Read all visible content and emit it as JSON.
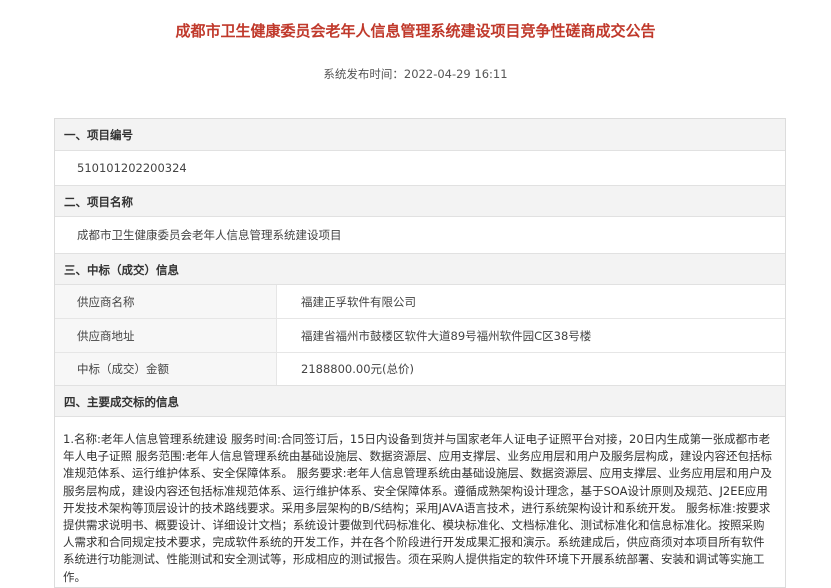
{
  "header": {
    "title": "成都市卫生健康委员会老年人信息管理系统建设项目竞争性磋商成交公告",
    "publish_time": "系统发布时间：2022-04-29 16:11"
  },
  "sections": {
    "s1": {
      "heading": "一、项目编号",
      "value": "510101202200324"
    },
    "s2": {
      "heading": "二、项目名称",
      "value": "成都市卫生健康委员会老年人信息管理系统建设项目"
    },
    "s3": {
      "heading": "三、中标（成交）信息",
      "rows": [
        {
          "key": "供应商名称",
          "value": "福建正孚软件有限公司"
        },
        {
          "key": "供应商地址",
          "value": "福建省福州市鼓楼区软件大道89号福州软件园C区38号楼"
        },
        {
          "key": "中标（成交）金额",
          "value": "2188800.00元(总价)"
        }
      ]
    },
    "s4": {
      "heading": "四、主要成交标的信息",
      "text": "1.名称:老年人信息管理系统建设 服务时间:合同签订后，15日内设备到货并与国家老年人证电子证照平台对接，20日内生成第一张成都市老年人电子证照 服务范围:老年人信息管理系统由基础设施层、数据资源层、应用支撑层、业务应用层和用户及服务层构成，建设内容还包括标准规范体系、运行维护体系、安全保障体系。 服务要求:老年人信息管理系统由基础设施层、数据资源层、应用支撑层、业务应用层和用户及服务层构成，建设内容还包括标准规范体系、运行维护体系、安全保障体系。遵循成熟架构设计理念，基于SOA设计原则及规范、J2EE应用开发技术架构等顶层设计的技术路线要求。采用多层架构的B/S结构；采用JAVA语言技术，进行系统架构设计和系统开发。 服务标准:按要求提供需求说明书、概要设计、详细设计文档；系统设计要做到代码标准化、模块标准化、文档标准化、测试标准化和信息标准化。按照采购人需求和合同规定技术要求，完成软件系统的开发工作，并在各个阶段进行开发成果汇报和演示。系统建成后，供应商须对本项目所有软件系统进行功能测试、性能测试和安全测试等，形成相应的测试报告。须在采购人提供指定的软件环境下开展系统部署、安装和调试等实施工作。"
    }
  }
}
